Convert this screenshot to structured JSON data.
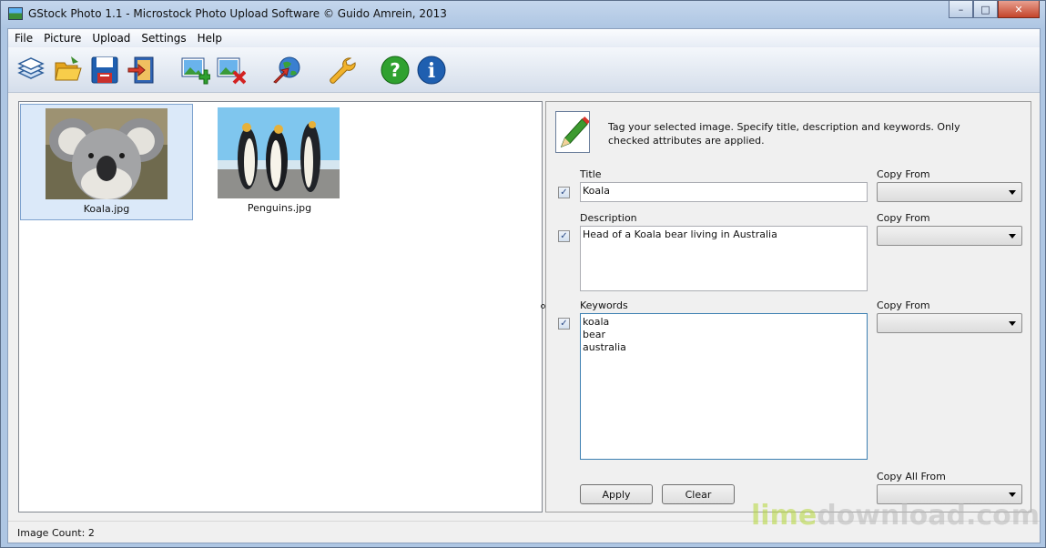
{
  "window": {
    "title": "GStock Photo 1.1 - Microstock Photo Upload Software © Guido Amrein, 2013",
    "minimize": "–",
    "maximize": "□",
    "close": "✕"
  },
  "menu": {
    "items": [
      "File",
      "Picture",
      "Upload",
      "Settings",
      "Help"
    ]
  },
  "toolbar": {
    "buttons": [
      {
        "icon": "layers-icon"
      },
      {
        "icon": "open-folder-icon"
      },
      {
        "icon": "save-icon"
      },
      {
        "icon": "exit-icon"
      },
      {
        "icon": "add-image-icon"
      },
      {
        "icon": "remove-image-icon"
      },
      {
        "icon": "upload-globe-icon"
      },
      {
        "icon": "wrench-icon"
      },
      {
        "icon": "help-icon"
      },
      {
        "icon": "info-icon"
      }
    ]
  },
  "images": [
    {
      "name": "Koala.jpg",
      "selected": true
    },
    {
      "name": "Penguins.jpg",
      "selected": false
    }
  ],
  "tag_panel": {
    "instructions": "Tag your selected image. Specify title, description and keywords. Only checked attributes are applied.",
    "title": {
      "label": "Title",
      "value": "Koala",
      "checked": true,
      "copy_label": "Copy From"
    },
    "description": {
      "label": "Description",
      "value": "Head of a Koala bear living in Australia",
      "checked": true,
      "copy_label": "Copy From"
    },
    "keywords": {
      "label": "Keywords",
      "value": "koala\nbear\naustralia",
      "checked": true,
      "copy_label": "Copy From"
    },
    "apply_label": "Apply",
    "clear_label": "Clear",
    "copy_all_label": "Copy All From",
    "check_mark": "✓"
  },
  "status": {
    "text": "Image Count: 2"
  },
  "watermark": {
    "part1": "lime",
    "part2": "download.com"
  },
  "colors": {
    "selection": "#dbe9f9",
    "watermark_green": "#b5d73a"
  }
}
